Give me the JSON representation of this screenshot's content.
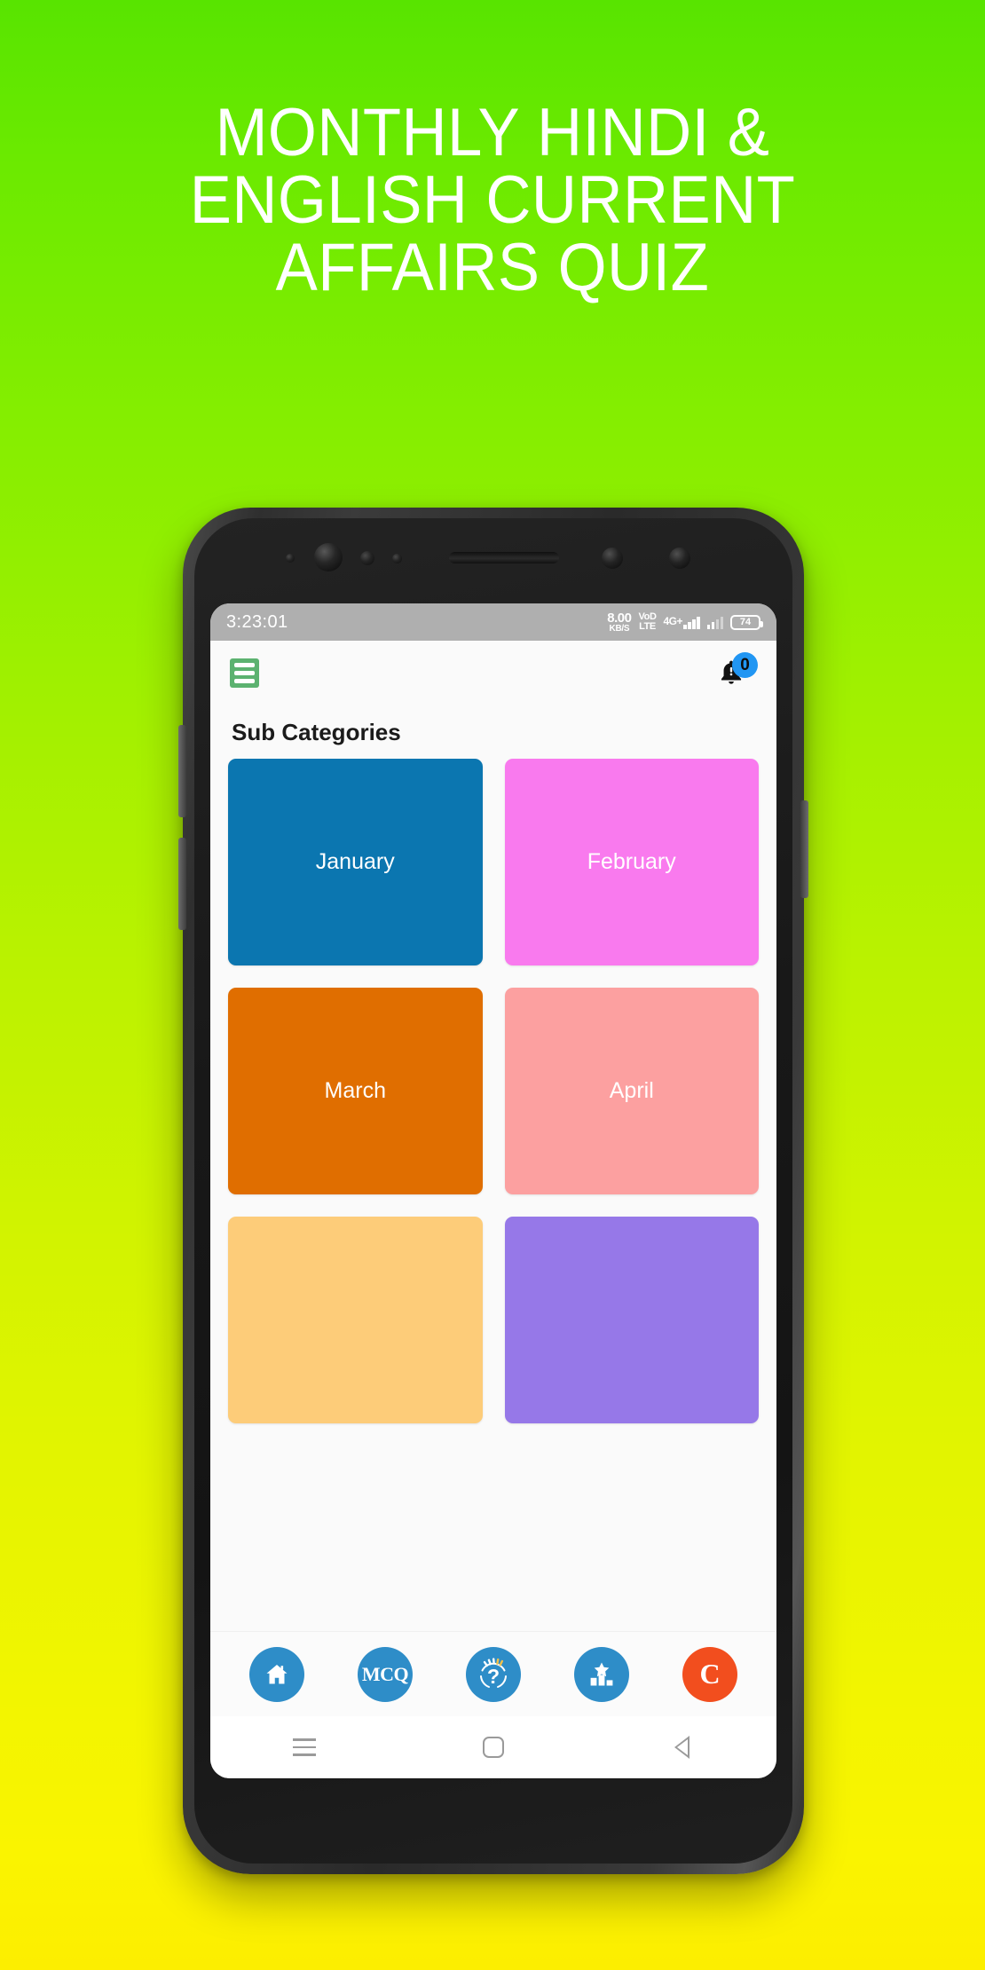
{
  "promo": {
    "headline": "MONTHLY HINDI &\nENGLISH CURRENT\nAFFAIRS QUIZ",
    "bg_top_color": "#58E400",
    "bg_bottom_color": "#FCEE00",
    "headline_color": "#FFFFFF"
  },
  "statusbar": {
    "time": "3:23:01",
    "data_rate_value": "8.00",
    "data_rate_unit": "KB/S",
    "volte_top": "VoD",
    "volte_bottom": "LTE",
    "network": "4G+",
    "battery_percent": "74",
    "background_color": "#AFAFAF"
  },
  "appbar": {
    "menu_icon": "hamburger-menu-icon",
    "menu_color": "#5CB270",
    "bell_icon": "bell-notification-icon",
    "badge_count": "0",
    "badge_color": "#2196F3"
  },
  "main": {
    "section_title": "Sub Categories",
    "tiles": [
      {
        "label": "January",
        "color": "#0B76B0"
      },
      {
        "label": "February",
        "color": "#F97AEE"
      },
      {
        "label": "March",
        "color": "#E06E00"
      },
      {
        "label": "April",
        "color": "#FCA0A0"
      },
      {
        "label": "",
        "color": "#FDCC79"
      },
      {
        "label": "",
        "color": "#9678E8"
      }
    ]
  },
  "bottomnav": {
    "items": [
      {
        "icon": "home-icon",
        "label": "",
        "color": "#2E8DC8"
      },
      {
        "icon": "mcq-icon",
        "label": "MCQ",
        "color": "#2E8DC8"
      },
      {
        "icon": "quiz-question-icon",
        "label": "QUIZ",
        "color": "#2E8DC8"
      },
      {
        "icon": "leaderboard-icon",
        "label": "",
        "color": "#2E8DC8"
      },
      {
        "icon": "category-c-icon",
        "label": "C",
        "color": "#F24E1E"
      }
    ]
  },
  "softkeys": {
    "recents": "recents-icon",
    "home": "home-square-icon",
    "back": "back-triangle-icon"
  }
}
